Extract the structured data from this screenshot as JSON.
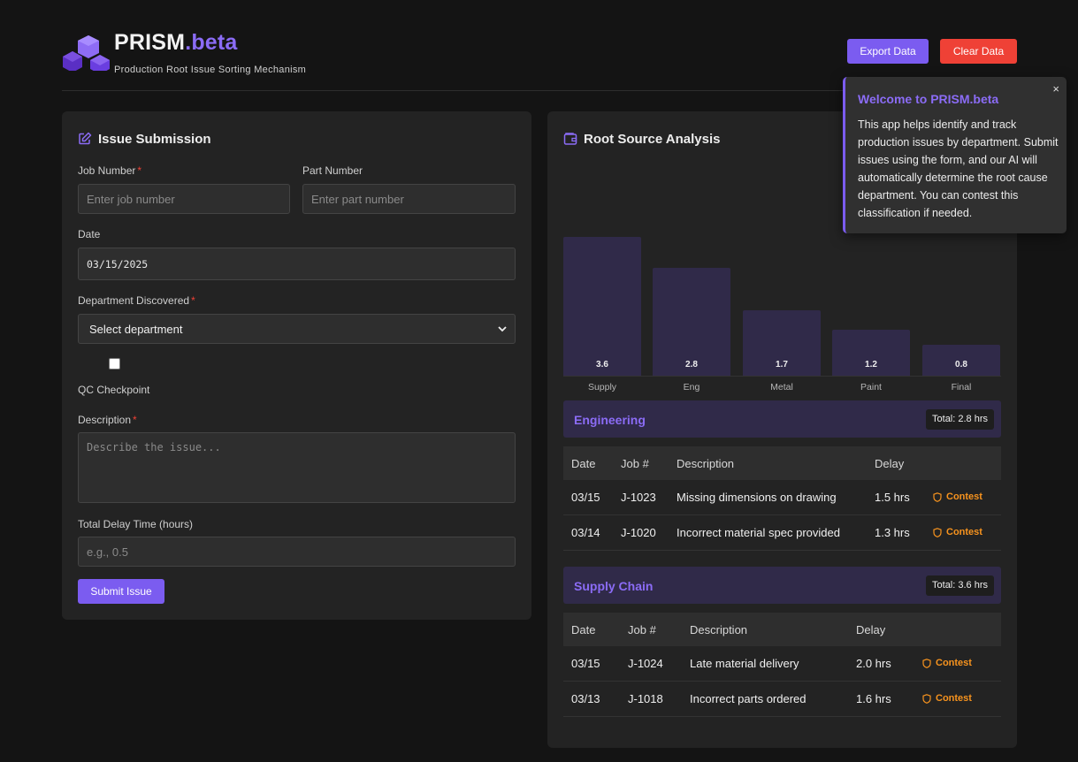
{
  "header": {
    "brand_name": "PRISM",
    "brand_suffix": ".beta",
    "tagline": "Production Root Issue Sorting Mechanism",
    "export_label": "Export Data",
    "clear_label": "Clear Data"
  },
  "form": {
    "title": "Issue Submission",
    "job_number": {
      "label": "Job Number",
      "required": "*",
      "placeholder": "Enter job number",
      "value": ""
    },
    "part_number": {
      "label": "Part Number",
      "placeholder": "Enter part number",
      "value": ""
    },
    "date": {
      "label": "Date",
      "value": "03/15/2025"
    },
    "department": {
      "label": "Department Discovered",
      "required": "*",
      "selected": "Select department"
    },
    "qc_checkpoint": {
      "label": "QC Checkpoint",
      "checked": false
    },
    "description": {
      "label": "Description",
      "required": "*",
      "placeholder": "Describe the issue...",
      "value": ""
    },
    "delay": {
      "label": "Total Delay Time (hours)",
      "placeholder": "e.g., 0.5",
      "value": ""
    },
    "submit_label": "Submit Issue"
  },
  "analysis": {
    "title": "Root Source Analysis"
  },
  "chart_data": {
    "type": "bar",
    "categories": [
      "Supply",
      "Eng",
      "Metal",
      "Paint",
      "Final"
    ],
    "values": [
      3.6,
      2.8,
      1.7,
      1.2,
      0.8
    ],
    "value_labels": [
      "3.6",
      "2.8",
      "1.7",
      "1.2",
      "0.8"
    ],
    "title": "",
    "xlabel": "",
    "ylabel": "",
    "ylim": [
      0,
      5.5
    ],
    "bar_color": "#302a49"
  },
  "departments": [
    {
      "name": "Engineering",
      "total": "Total: 2.8 hrs",
      "columns": [
        "Date",
        "Job #",
        "Description",
        "Delay"
      ],
      "rows": [
        {
          "date": "03/15",
          "job": "J-1023",
          "description": "Missing dimensions on drawing",
          "delay": "1.5 hrs",
          "action": "Contest"
        },
        {
          "date": "03/14",
          "job": "J-1020",
          "description": "Incorrect material spec provided",
          "delay": "1.3 hrs",
          "action": "Contest"
        }
      ]
    },
    {
      "name": "Supply Chain",
      "total": "Total: 3.6 hrs",
      "columns": [
        "Date",
        "Job #",
        "Description",
        "Delay"
      ],
      "rows": [
        {
          "date": "03/15",
          "job": "J-1024",
          "description": "Late material delivery",
          "delay": "2.0 hrs",
          "action": "Contest"
        },
        {
          "date": "03/13",
          "job": "J-1018",
          "description": "Incorrect parts ordered",
          "delay": "1.6 hrs",
          "action": "Contest"
        }
      ]
    }
  ],
  "welcome": {
    "title": "Welcome to PRISM.beta",
    "body": "This app helps identify and track production issues by department. Submit issues using the form, and our AI will automatically determine the root cause department. You can contest this classification if needed.",
    "close": "×"
  },
  "colors": {
    "accent": "#7b5cf0",
    "accent_text": "#8b6cf6",
    "danger": "#ef4136",
    "contest": "#f7931e"
  },
  "icons": [
    "prism-logo-icon",
    "edit-icon",
    "wallet-icon",
    "chevron-down-icon",
    "shield-icon"
  ]
}
